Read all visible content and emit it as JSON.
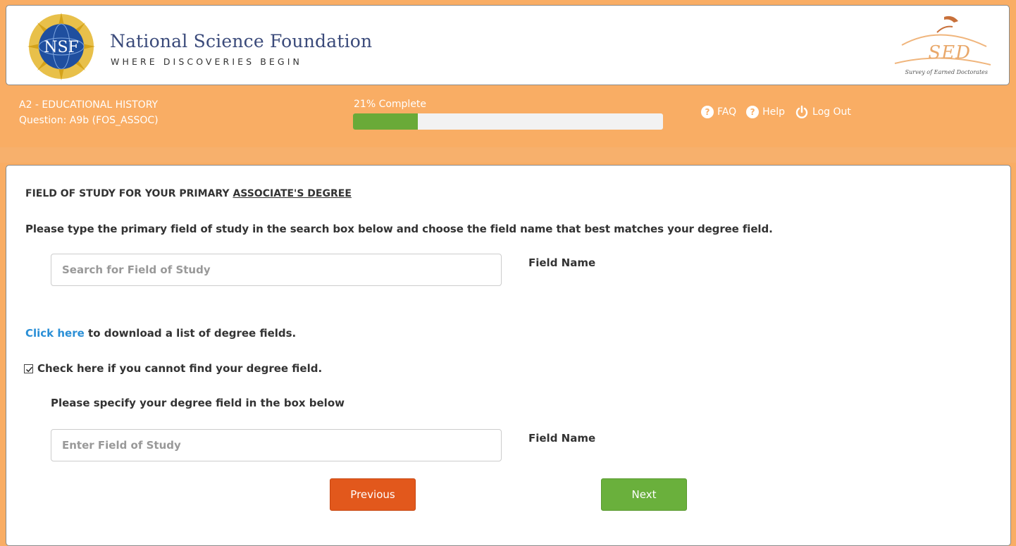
{
  "header": {
    "org_name": "National Science Foundation",
    "org_tagline": "WHERE DISCOVERIES BEGIN",
    "seal_text": "NSF",
    "survey_logo_text": "SED",
    "survey_logo_subtext": "Survey of Earned Doctorates"
  },
  "status": {
    "section_title": "A2 - EDUCATIONAL HISTORY",
    "question_id": "Question: A9b (FOS_ASSOC)",
    "progress_label": "21% Complete",
    "progress_percent": 21,
    "links": {
      "faq": "FAQ",
      "help": "Help",
      "logout": "Log Out"
    }
  },
  "question": {
    "heading_prefix": "FIELD OF STUDY FOR YOUR PRIMARY ",
    "heading_emphasis": "ASSOCIATE'S DEGREE",
    "instruction": "Please type the primary field of study in the search box below and choose the field name that best matches your degree field.",
    "search_placeholder": "Search for Field of Study",
    "field_name_label_1": "Field Name",
    "download_link": "Click here",
    "download_suffix": " to download a list of degree fields.",
    "cannot_find_label": "Check here if you cannot find your degree field.",
    "cannot_find_checked": true,
    "specify_label": "Please specify your degree field in the box below",
    "specify_placeholder": "Enter Field of Study",
    "field_name_label_2": "Field Name"
  },
  "nav": {
    "previous": "Previous",
    "next": "Next"
  },
  "colors": {
    "header_orange": "#f9ad64",
    "progress_green": "#6aaa38",
    "previous_button": "#e2581c",
    "next_button": "#6ab03c",
    "link_blue": "#2a8fd6"
  }
}
